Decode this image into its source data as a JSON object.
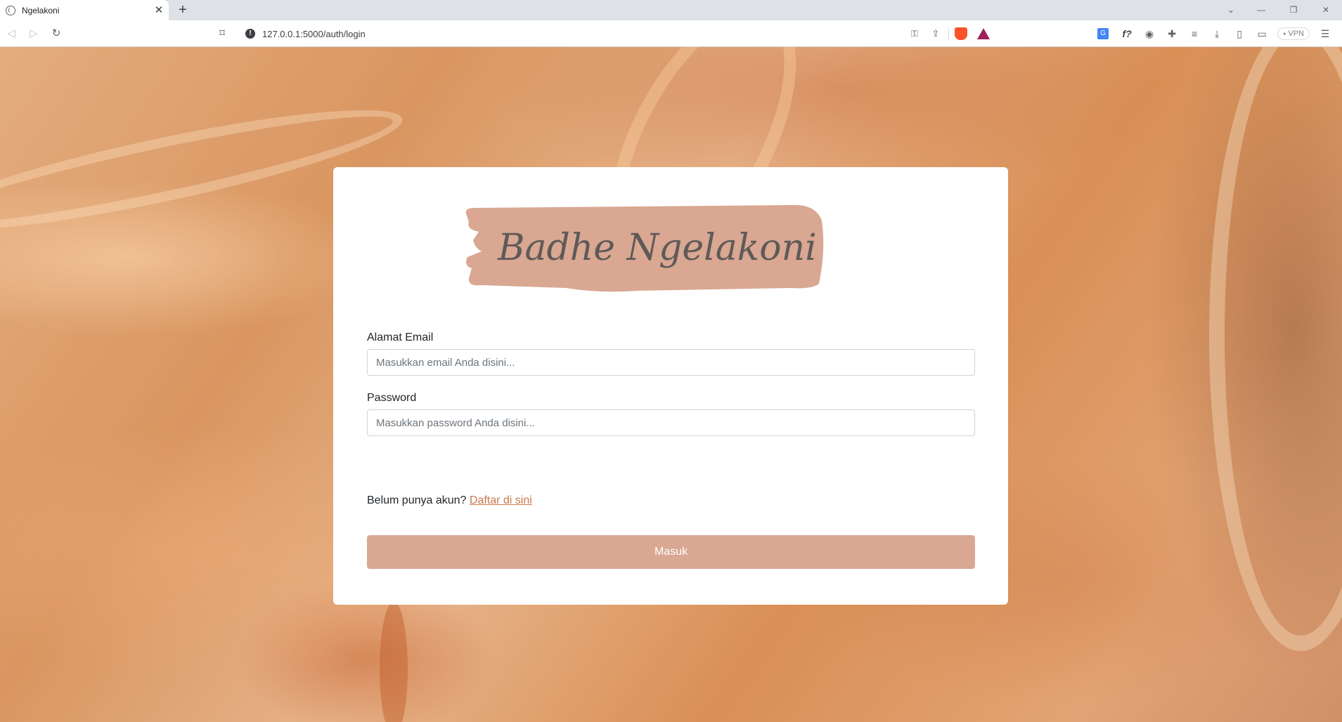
{
  "browser": {
    "tab_title": "Ngelakoni",
    "tab_close": "✕",
    "new_tab": "+",
    "url": "127.0.0.1:5000/auth/login",
    "vpn_label": "VPN"
  },
  "login": {
    "logo_text": "Badhe Ngelakoni",
    "email_label": "Alamat Email",
    "email_placeholder": "Masukkan email Anda disini...",
    "email_value": "",
    "password_label": "Password",
    "password_placeholder": "Masukkan password Anda disini...",
    "password_value": "",
    "signup_prompt": "Belum punya akun?",
    "signup_link": "Daftar di sini",
    "submit_label": "Masuk"
  },
  "colors": {
    "accent": "#d9a792",
    "link": "#c9794b",
    "logo_text": "#5f5a58"
  }
}
